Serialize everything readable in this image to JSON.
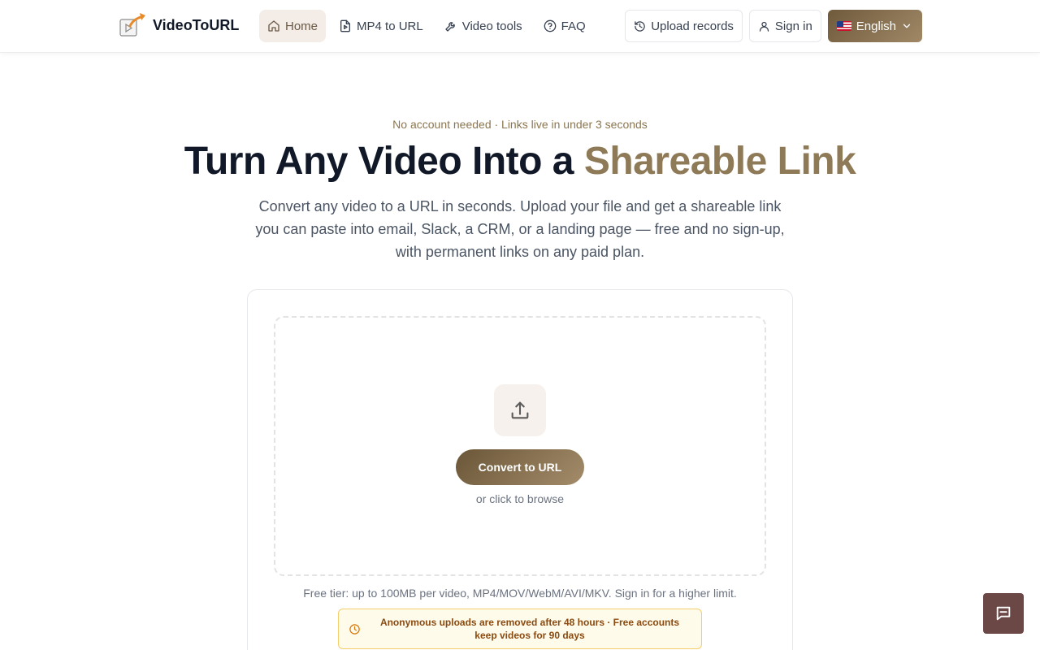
{
  "brand": {
    "name": "VideoToURL"
  },
  "nav": {
    "items": [
      {
        "label": "Home",
        "icon": "home-icon",
        "active": true
      },
      {
        "label": "MP4 to URL",
        "icon": "file-video-icon",
        "active": false
      },
      {
        "label": "Video tools",
        "icon": "wrench-icon",
        "active": false
      },
      {
        "label": "FAQ",
        "icon": "help-circle-icon",
        "active": false
      }
    ]
  },
  "header_actions": {
    "upload_records": "Upload records",
    "sign_in": "Sign in",
    "language": "English"
  },
  "hero": {
    "tagline": "No account needed · Links live in under 3 seconds",
    "title_main": "Turn Any Video Into a ",
    "title_accent": "Shareable Link",
    "subtitle": "Convert any video to a URL in seconds. Upload your file and get a shareable link you can paste into email, Slack, a CRM, or a landing page — free and no sign-up, with permanent links on any paid plan."
  },
  "upload": {
    "button": "Convert to URL",
    "browse": "or click to browse",
    "limit": "Free tier: up to 100MB per video, MP4/MOV/WebM/AVI/MKV. Sign in for a higher limit.",
    "notice": "Anonymous uploads are removed after 48 hours · Free accounts keep videos for 90 days"
  },
  "colors": {
    "accent": "#8f7a58",
    "button_gradient_start": "#6a5638",
    "button_gradient_end": "#a48c6a",
    "notice_bg": "#fffbeb",
    "notice_border": "#f5cd6b",
    "chat_button": "#6b4845"
  }
}
